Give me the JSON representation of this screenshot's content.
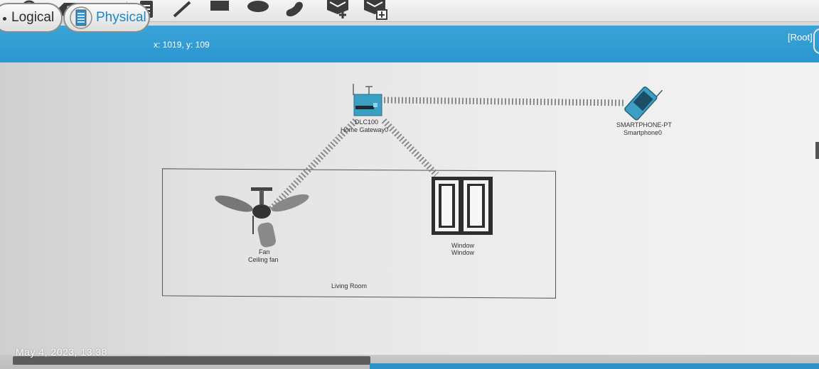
{
  "toolbar": {
    "tools": [
      {
        "icon": "search-icon"
      },
      {
        "icon": "delete-icon"
      },
      {
        "icon": "resize-icon"
      },
      {
        "icon": "note-icon"
      },
      {
        "icon": "line-draw-icon"
      },
      {
        "icon": "rectangle-icon"
      },
      {
        "icon": "ellipse-icon"
      },
      {
        "icon": "freeform-icon"
      },
      {
        "icon": "add-pdu-icon"
      },
      {
        "icon": "add-complex-pdu-icon"
      }
    ]
  },
  "modebar": {
    "logical_label": "Logical",
    "physical_label": "Physical",
    "coordinates": "x: 1019, y: 109",
    "root_label": "[Root]"
  },
  "workspace": {
    "gateway": {
      "model": "DLC100",
      "name": "Home Gateway0"
    },
    "smartphone": {
      "model": "SMARTPHONE-PT",
      "name": "Smartphone0"
    },
    "fan": {
      "model": "Fan",
      "name": "Ceiling fan"
    },
    "window": {
      "model": "Window",
      "name": "Window"
    },
    "room_label": "Living Room"
  },
  "overlay": {
    "timestamp": "May 4, 2023, 13:38"
  },
  "colors": {
    "accent_blue": "#2b96cf",
    "physical_text": "#1d86c6",
    "gateway_teal": "#3a9fc2"
  }
}
